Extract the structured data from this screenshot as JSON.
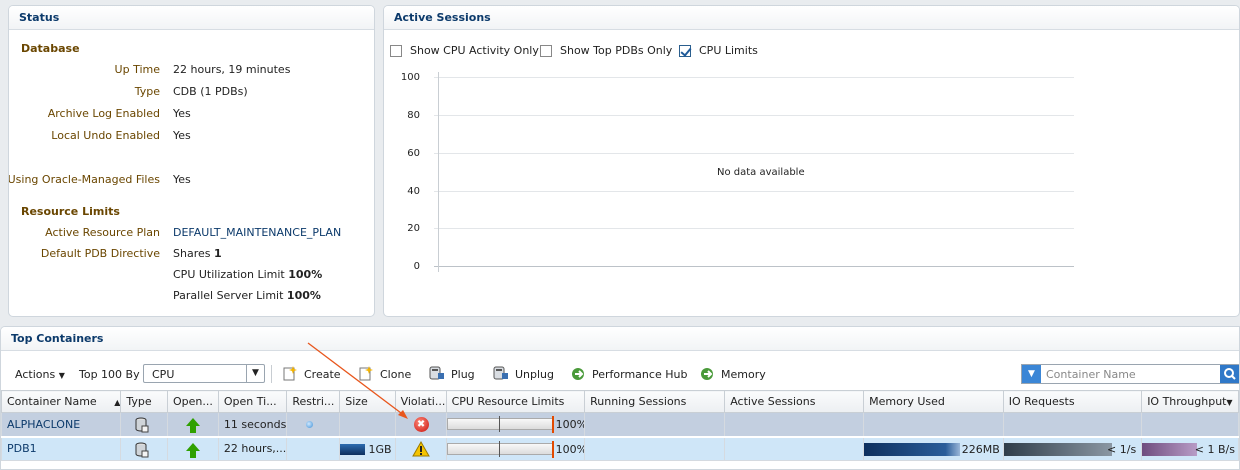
{
  "status": {
    "title": "Status",
    "database_header": "Database",
    "rows": [
      {
        "label": "Up Time",
        "value": "22 hours, 19 minutes"
      },
      {
        "label": "Type",
        "value": "CDB (1 PDBs)"
      },
      {
        "label": "Archive Log Enabled",
        "value": "Yes"
      },
      {
        "label": "Local Undo Enabled",
        "value": "Yes"
      },
      {
        "label": "Using Oracle-Managed Files",
        "value": "Yes"
      }
    ],
    "resource_header": "Resource Limits",
    "active_plan_label": "Active Resource Plan",
    "active_plan_value": "DEFAULT_MAINTENANCE_PLAN",
    "pdb_directive_label": "Default PDB Directive",
    "shares_label": "Shares",
    "shares_value": "1",
    "cpu_limit_label": "CPU Utilization Limit",
    "cpu_limit_value": "100%",
    "parallel_label": "Parallel Server Limit",
    "parallel_value": "100%"
  },
  "active_sessions": {
    "title": "Active Sessions",
    "checkboxes": [
      {
        "label": "Show CPU Activity Only",
        "checked": false
      },
      {
        "label": "Show Top PDBs Only",
        "checked": false
      },
      {
        "label": "CPU Limits",
        "checked": true
      }
    ],
    "y_ticks": [
      "100",
      "80",
      "60",
      "40",
      "20",
      "0"
    ],
    "empty_message": "No data available"
  },
  "chart_data": {
    "type": "area",
    "title": "",
    "series": [],
    "ylim": [
      0,
      100
    ],
    "y_ticks": [
      0,
      20,
      40,
      60,
      80,
      100
    ],
    "grid": true,
    "empty_message": "No data available"
  },
  "top_containers": {
    "title": "Top Containers",
    "actions_label": "Actions",
    "top_by_label": "Top 100 By",
    "top_by_value": "CPU",
    "buttons": [
      "Create",
      "Clone",
      "Plug",
      "Unplug",
      "Performance Hub",
      "Memory"
    ],
    "search_placeholder": "Container Name",
    "columns": [
      "Container Name",
      "Type",
      "Open...",
      "Open Ti...",
      "Restri...",
      "Size",
      "Violati...",
      "CPU Resource Limits",
      "Running Sessions",
      "Active Sessions",
      "Memory Used",
      "IO Requests",
      "IO Throughput"
    ],
    "rows": [
      {
        "name": "ALPHACLONE",
        "open_time": "11 seconds",
        "size": "",
        "cpu_pct": "100%",
        "memory": "",
        "io_requests": "",
        "io_throughput": "",
        "violation": "error"
      },
      {
        "name": "PDB1",
        "open_time": "22 hours,...",
        "size": "1GB",
        "cpu_pct": "100%",
        "memory": "226MB",
        "io_requests": "< 1/s",
        "io_throughput": "< 1 B/s",
        "violation": "warning"
      }
    ],
    "pdb1_memory_fill": 0.6,
    "pdb1_io_fill": 0.45,
    "pdb1_throughput_fill": 0.5
  },
  "colors": {
    "title": "#0c3a6b",
    "label": "#6a4600",
    "accent": "#3b86d6",
    "annotation_arrow": "#e8561c"
  }
}
